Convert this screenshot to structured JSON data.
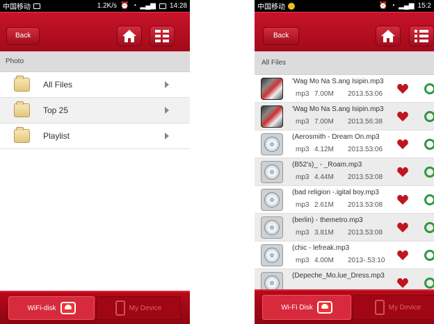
{
  "left": {
    "status": {
      "carrier": "中国移动",
      "speed": "1.2K/s",
      "time": "14:28"
    },
    "header": {
      "back_label": "Back"
    },
    "section_label": "Photo",
    "menu": [
      {
        "label": "All Files"
      },
      {
        "label": "Top 25"
      },
      {
        "label": "Playlist"
      }
    ],
    "tabs": {
      "wifi_label": "WiFi-disk",
      "device_label": "My Device"
    }
  },
  "right": {
    "status": {
      "carrier": "中国移动",
      "time": "15:2"
    },
    "header": {
      "back_label": "Back"
    },
    "section_label": "All Files",
    "files": [
      {
        "title": "'Wag Mo Na S.ang Isipin.mp3",
        "type": "mp3",
        "size": "7.00M",
        "date": "2013.53:06",
        "thumb": "album"
      },
      {
        "title": "'Wag Mo Na S.ang Isipin.mp3",
        "type": "mp3",
        "size": "7.00M",
        "date": "2013.56:38",
        "thumb": "album"
      },
      {
        "title": "(Aerosmith - Dream On.mp3",
        "type": "mp3",
        "size": "4.12M",
        "date": "2013.53:06",
        "thumb": "disc"
      },
      {
        "title": "(B52's)_ - _Roam.mp3",
        "type": "mp3",
        "size": "4.44M",
        "date": "2013.53:08",
        "thumb": "disc"
      },
      {
        "title": "(bad religion -.igital boy.mp3",
        "type": "mp3",
        "size": "2.61M",
        "date": "2013.53:08",
        "thumb": "disc"
      },
      {
        "title": "(berlin) - themetro.mp3",
        "type": "mp3",
        "size": "3.81M",
        "date": "2013.53:08",
        "thumb": "disc"
      },
      {
        "title": "(chic - lefreak.mp3",
        "type": "mp3",
        "size": "4.00M",
        "date": "2013-.53:10",
        "thumb": "disc"
      },
      {
        "title": "(Depeche_Mo.lue_Dress.mp3",
        "type": "",
        "size": "",
        "date": "",
        "thumb": "disc"
      }
    ],
    "tabs": {
      "wifi_label": "Wi-Fi Disk",
      "device_label": "My Device"
    }
  },
  "colors": {
    "brand_red": "#b8091a",
    "favorite_red": "#c0141e",
    "share_green": "#2c9a3c"
  }
}
